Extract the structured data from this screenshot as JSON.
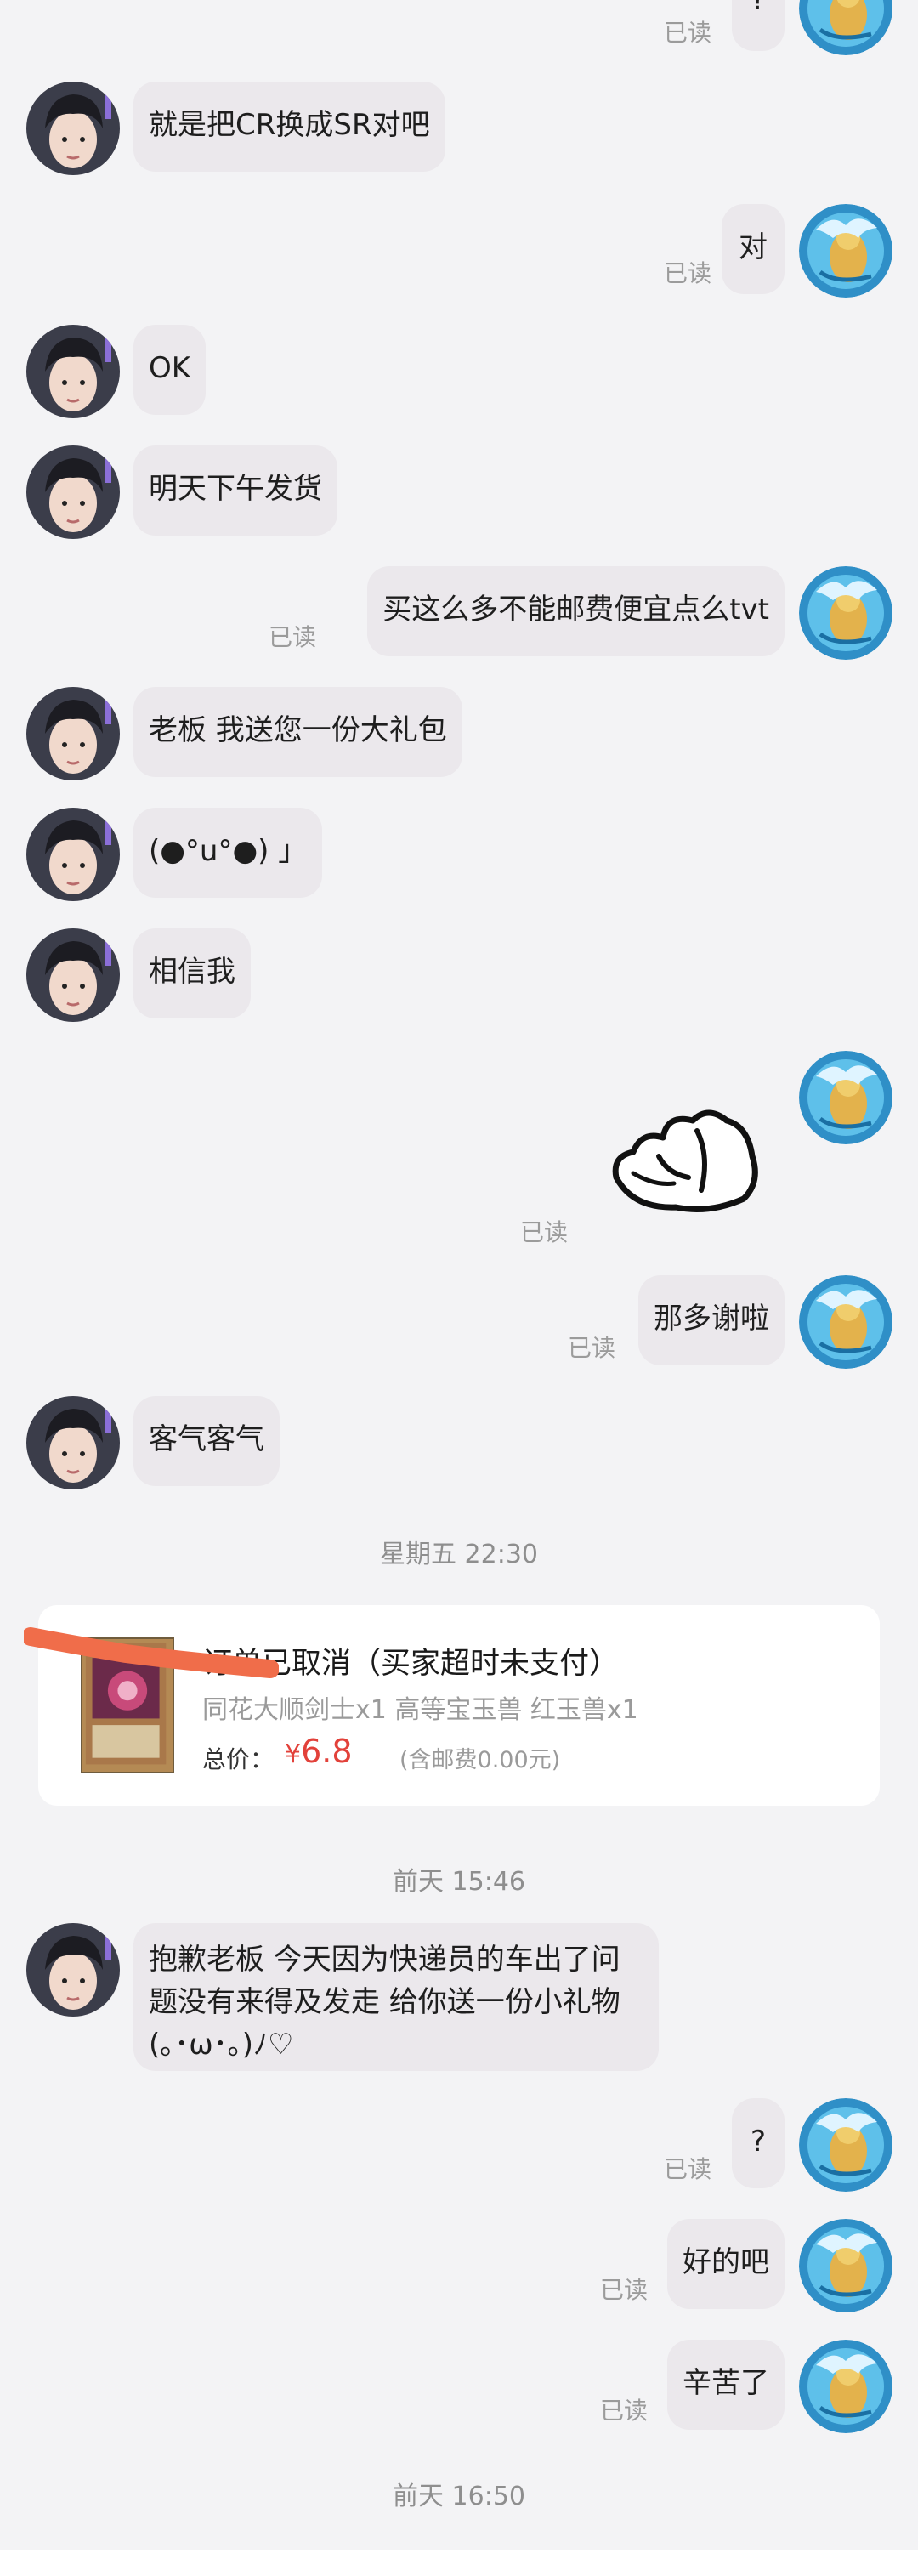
{
  "messages": [
    {
      "side": "right",
      "text": "?",
      "read": "已读"
    },
    {
      "side": "left",
      "text": "就是把CR换成SR对吧"
    },
    {
      "side": "right",
      "text": "对",
      "read": "已读"
    },
    {
      "side": "left",
      "text": "OK"
    },
    {
      "side": "left",
      "text": "明天下午发货"
    },
    {
      "side": "right",
      "text": "买这么多不能邮费便宜点么tvt",
      "read": "已读"
    },
    {
      "side": "left",
      "text": "老板 我送您一份大礼包"
    },
    {
      "side": "left",
      "text": "(●°u°●)​ 」"
    },
    {
      "side": "left",
      "text": "相信我"
    },
    {
      "side": "right",
      "sticker": "hands-sticker",
      "read": "已读"
    },
    {
      "side": "right",
      "text": "那多谢啦",
      "read": "已读"
    },
    {
      "side": "left",
      "text": "客气客气"
    },
    {
      "side": "left",
      "text": "抱歉老板 今天因为快递员的车出了问题没有来得及发走 给你送一份小礼物(｡･ω･｡)ﾉ♡"
    },
    {
      "side": "right",
      "text": "?",
      "read": "已读"
    },
    {
      "side": "right",
      "text": "好的吧",
      "read": "已读"
    },
    {
      "side": "right",
      "text": "辛苦了",
      "read": "已读"
    }
  ],
  "timestamps": {
    "t1": "星期五 22:30",
    "t2": "前天 15:46",
    "t3": "前天 16:50"
  },
  "order": {
    "title": "订单已取消（买家超时未支付）",
    "items": "同花大顺剑士x1 高等宝玉兽 红玉兽x1",
    "total_label": "总价：",
    "currency": "¥",
    "price": "6.8",
    "shipping": "(含邮费0.00元)"
  },
  "colors": {
    "background": "#f3f3f5",
    "bubble": "#ebe8ec",
    "price": "#e2413a",
    "read_receipt": "#9b9b9b"
  },
  "icons": {
    "self_avatar": "anime-beast-avatar",
    "other_avatar": "user-avatar",
    "sticker": "hands-sticker"
  }
}
